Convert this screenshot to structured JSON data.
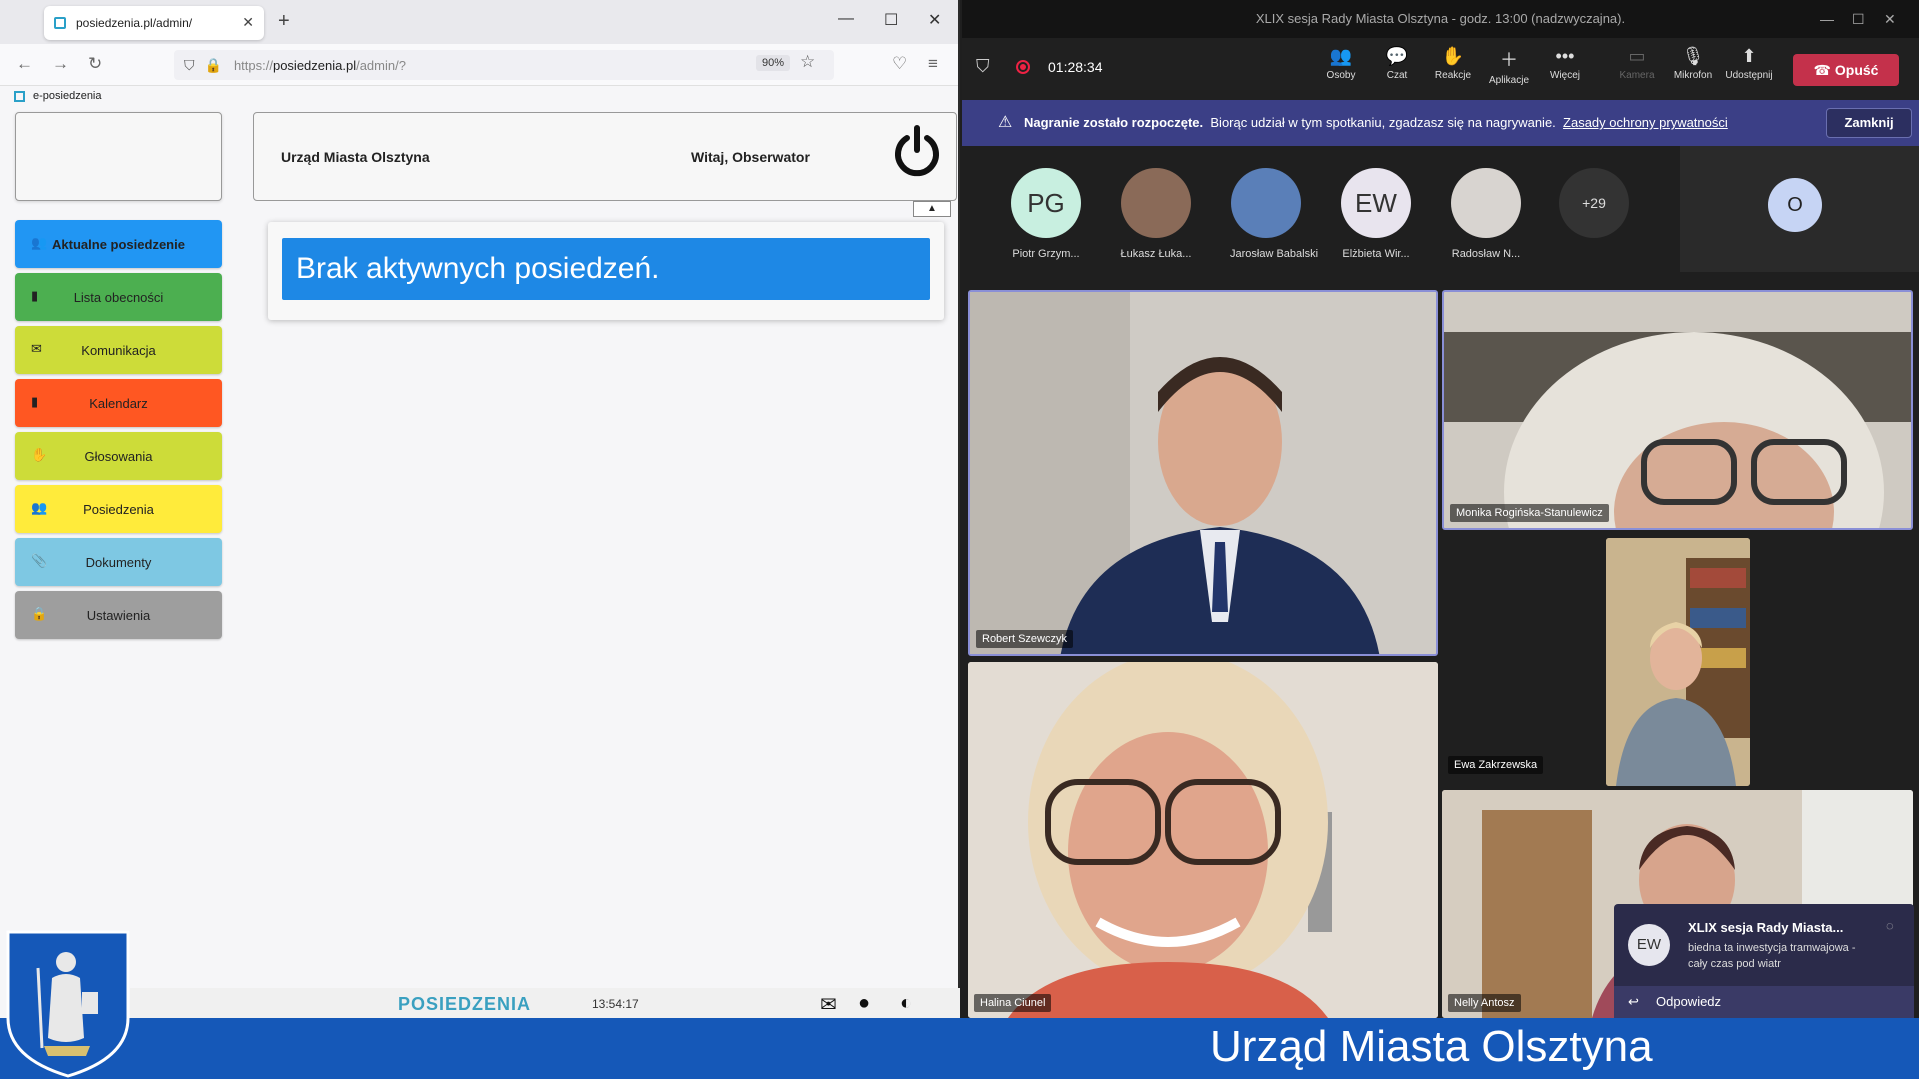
{
  "browser": {
    "tab_title": "posiedzenia.pl/admin/",
    "new_tab": "+",
    "url_prefix": "https://",
    "url_host": "posiedzenia.pl",
    "url_path": "/admin/?",
    "zoom": "90%",
    "bookmark": "e-posiedzenia"
  },
  "header": {
    "org": "Urząd Miasta Olsztyna",
    "greeting": "Witaj, Obserwator"
  },
  "menu": [
    {
      "label": "Aktualne posiedzenie",
      "color": "#2196f3",
      "icon": "users-icon",
      "glyph": "👥"
    },
    {
      "label": "Lista obecności",
      "color": "#4caf50",
      "icon": "list-icon",
      "glyph": "▮"
    },
    {
      "label": "Komunikacja",
      "color": "#cddc39",
      "icon": "envelope-icon",
      "glyph": "✉"
    },
    {
      "label": "Kalendarz",
      "color": "#ff5722",
      "icon": "calendar-icon",
      "glyph": "▮"
    },
    {
      "label": "Głosowania",
      "color": "#cddc39",
      "icon": "hand-icon",
      "glyph": "✋"
    },
    {
      "label": "Posiedzenia",
      "color": "#ffeb3b",
      "icon": "group-icon",
      "glyph": "👥"
    },
    {
      "label": "Dokumenty",
      "color": "#7ec8e3",
      "icon": "paperclip-icon",
      "glyph": "📎"
    },
    {
      "label": "Ustawienia",
      "color": "#9e9e9e",
      "icon": "lock-icon",
      "glyph": "🔒"
    }
  ],
  "notice": "Brak aktywnych posiedzeń.",
  "footer": {
    "brand": "POSIEDZENIA",
    "clock": "13:54:17"
  },
  "teams": {
    "title": "XLIX sesja Rady Miasta Olsztyna - godz. 13:00 (nadzwyczajna).",
    "timer": "01:28:34",
    "toolbar": [
      "Osoby",
      "Czat",
      "Reakcje",
      "Aplikacje",
      "Więcej",
      "Kamera",
      "Mikrofon",
      "Udostępnij"
    ],
    "leave": "Opuść",
    "banner_bold": "Nagranie zostało rozpoczęte.",
    "banner_text": "Biorąc udział w tym spotkaniu, zgadzasz się na nagrywanie.",
    "banner_link": "Zasady ochrony prywatności",
    "banner_close": "Zamknij",
    "roster": [
      {
        "initials": "PG",
        "name": "Piotr Grzym...",
        "bg": "#c8efe0"
      },
      {
        "initials": "",
        "name": "Łukasz Łuka...",
        "bg": "#8a6a58"
      },
      {
        "initials": "",
        "name": "Jarosław Babalski",
        "bg": "#5a7fb8"
      },
      {
        "initials": "EW",
        "name": "Elżbieta Wir...",
        "bg": "#e8e4ee"
      },
      {
        "initials": "",
        "name": "Radosław N...",
        "bg": "#d8d4d0"
      }
    ],
    "more": "+29",
    "self_initial": "O",
    "videos": [
      "Robert Szewczyk",
      "Monika Rogińska-Stanulewicz",
      "Ewa Zakrzewska",
      "Halina Ciunel",
      "Nelly Antosz"
    ],
    "chat": {
      "initials": "EW",
      "title": "XLIX sesja Rady Miasta...",
      "message": "biedna ta inwestycja tramwajowa - cały czas pod wiatr",
      "reply": "Odpowiedz"
    }
  },
  "band": "Urząd Miasta Olsztyna"
}
